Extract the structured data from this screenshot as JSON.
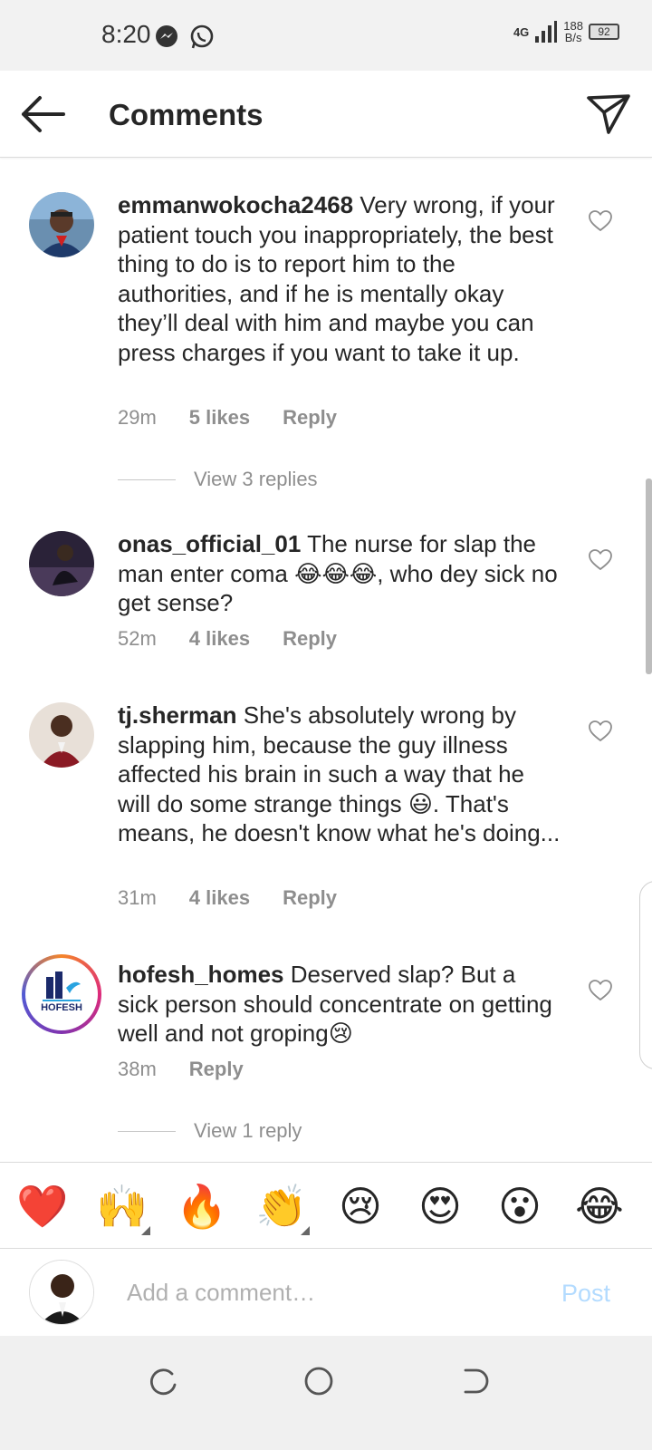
{
  "status_bar": {
    "time": "8:20",
    "network": "4G",
    "speed_value": "188",
    "speed_unit": "B/s",
    "battery": "92"
  },
  "header": {
    "title": "Comments"
  },
  "comments": [
    {
      "username": "emmanwokocha2468",
      "text": "Very wrong, if your patient touch you inappropriately, the best thing to do is to report him to the authorities, and if he is mentally okay they’ll deal with him and maybe you can press charges if you want to take it up.",
      "time": "29m",
      "likes": "5 likes",
      "reply": "Reply",
      "view_replies": "View 3 replies"
    },
    {
      "username": "onas_official_01",
      "text": "The nurse for slap the man enter coma 😂😂😂, who dey sick no get sense?",
      "time": "52m",
      "likes": "4 likes",
      "reply": "Reply"
    },
    {
      "username": "tj.sherman",
      "text": "She's absolutely wrong by slapping him, because the guy illness affected his brain in such a way that he will do some strange things 😃. That's means, he doesn't know what he's doing...",
      "time": "31m",
      "likes": "4 likes",
      "reply": "Reply"
    },
    {
      "username": "hofesh_homes",
      "text": "Deserved slap? But a sick person should concentrate on getting well and not groping😢",
      "time": "38m",
      "reply": "Reply",
      "view_replies": "View 1 reply",
      "avatar_logo_text": "HOFESH"
    }
  ],
  "emoji_bar": [
    "❤️",
    "🙌",
    "🔥",
    "👏",
    "😢",
    "😍",
    "😮",
    "😂"
  ],
  "add_comment": {
    "placeholder": "Add a comment…",
    "post_label": "Post"
  },
  "colors": {
    "link_blue_disabled": "#b3dbff",
    "meta_gray": "#8e8e8e",
    "text": "#262626"
  }
}
